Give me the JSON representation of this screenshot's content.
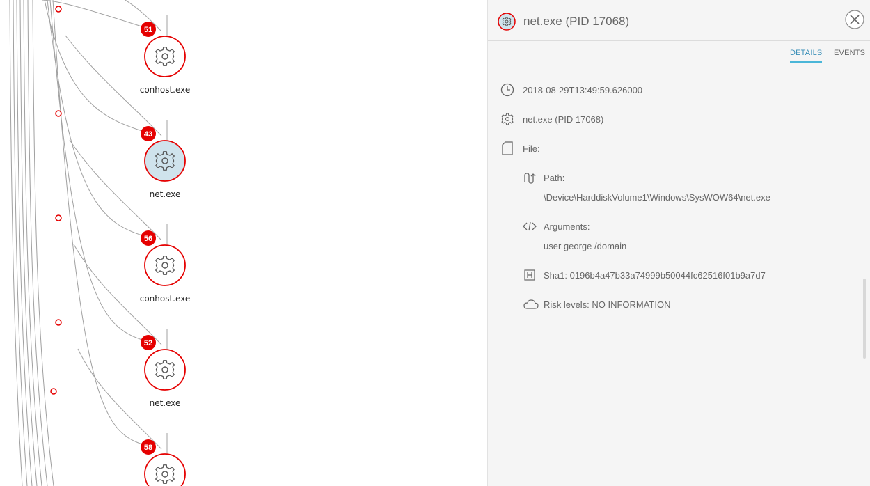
{
  "graph": {
    "nodes": [
      {
        "badge": "51",
        "label": "conhost.exe",
        "selected": false
      },
      {
        "badge": "43",
        "label": "net.exe",
        "selected": true
      },
      {
        "badge": "56",
        "label": "conhost.exe",
        "selected": false
      },
      {
        "badge": "52",
        "label": "net.exe",
        "selected": false
      },
      {
        "badge": "58",
        "label": "",
        "selected": false
      }
    ],
    "colors": {
      "accent_red": "#e50000",
      "selected_fill": "#cfe3ec",
      "edge": "#a0a0a0"
    }
  },
  "panel": {
    "title": "net.exe (PID 17068)",
    "tabs": [
      {
        "label": "DETAILS",
        "active": true
      },
      {
        "label": "EVENTS",
        "active": false
      }
    ],
    "timestamp": "2018-08-29T13:49:59.626000",
    "process": "net.exe (PID 17068)",
    "file_label": "File:",
    "path_label": "Path:",
    "path_value": "\\Device\\HarddiskVolume1\\Windows\\SysWOW64\\net.exe",
    "arguments_label": "Arguments:",
    "arguments_value": "user george /domain",
    "sha1": "Sha1: 0196b4a47b33a74999b50044fc62516f01b9a7d7",
    "risk": "Risk levels: NO INFORMATION",
    "colors": {
      "tab_active": "#4ab6d8",
      "panel_bg": "#f5f5f5"
    },
    "icons": [
      "gear-icon",
      "close-icon",
      "clock-icon",
      "file-icon",
      "path-icon",
      "code-icon",
      "hash-icon",
      "cloud-icon"
    ]
  }
}
